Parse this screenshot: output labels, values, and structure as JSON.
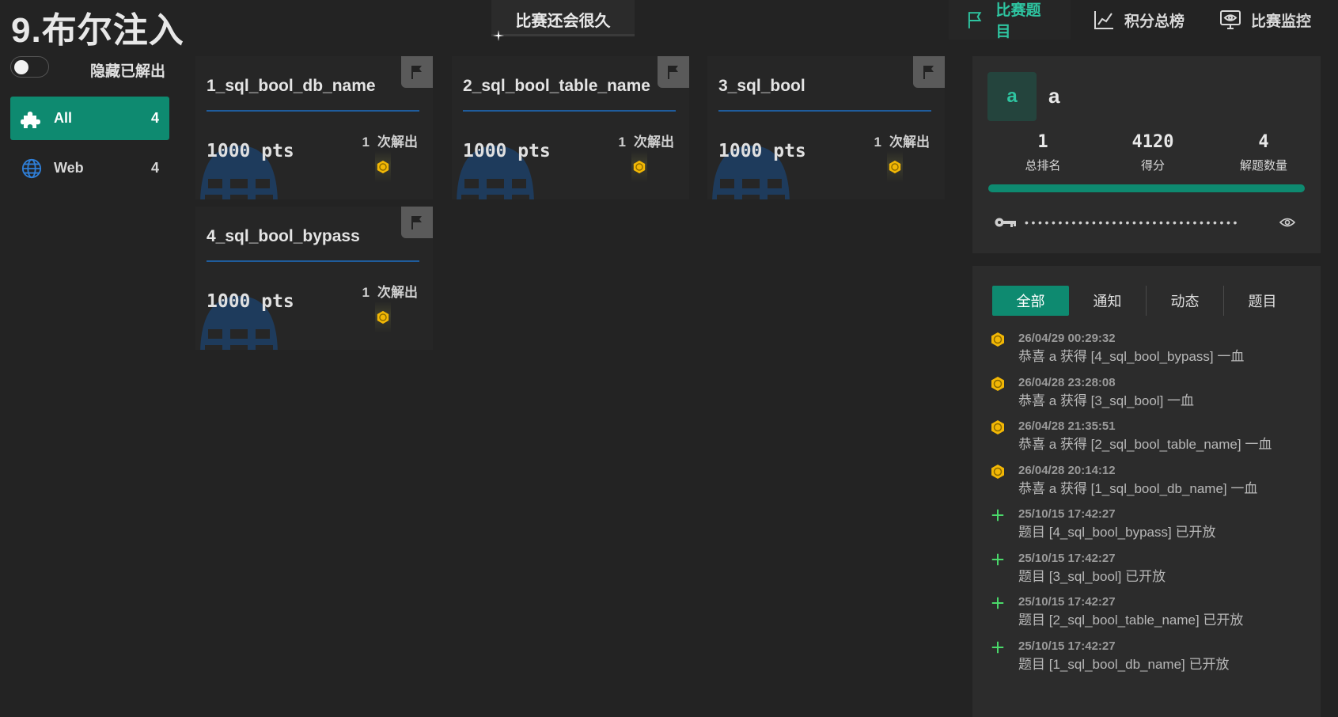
{
  "header": {
    "game_title": "9.布尔注入",
    "countdown": "比赛还会很久",
    "nav": [
      {
        "label": "比赛题目",
        "icon": "flag-icon",
        "active": true
      },
      {
        "label": "积分总榜",
        "icon": "chart-line-icon",
        "active": false
      },
      {
        "label": "比赛监控",
        "icon": "monitor-eye-icon",
        "active": false
      }
    ]
  },
  "sidebar": {
    "hide_solved_label": "隐藏已解出",
    "hide_solved_on": false,
    "categories": [
      {
        "name": "All",
        "count": "4",
        "icon": "puzzle-icon",
        "active": true
      },
      {
        "name": "Web",
        "count": "4",
        "icon": "globe-icon",
        "active": false
      }
    ]
  },
  "challenges": [
    {
      "title": "1_sql_bool_db_name",
      "points": "1000 pts",
      "solves": "1",
      "solves_label": "次解出"
    },
    {
      "title": "2_sql_bool_table_name",
      "points": "1000 pts",
      "solves": "1",
      "solves_label": "次解出"
    },
    {
      "title": "3_sql_bool",
      "points": "1000 pts",
      "solves": "1",
      "solves_label": "次解出"
    },
    {
      "title": "4_sql_bool_bypass",
      "points": "1000 pts",
      "solves": "1",
      "solves_label": "次解出"
    }
  ],
  "user": {
    "avatar_letter": "a",
    "name": "a",
    "rank": "1",
    "rank_label": "总排名",
    "score": "4120",
    "score_label": "得分",
    "solved": "4",
    "solved_label": "解题数量",
    "progress": 1.0,
    "token_masked": "••••••••••••••••••••••••••••••••"
  },
  "notices": {
    "tabs": [
      "全部",
      "通知",
      "动态",
      "题目"
    ],
    "active_tab": 0,
    "items": [
      {
        "type": "blood",
        "time": "26/04/29 00:29:32",
        "message": "恭喜 a 获得 [4_sql_bool_bypass] 一血"
      },
      {
        "type": "blood",
        "time": "26/04/28 23:28:08",
        "message": "恭喜 a 获得 [3_sql_bool] 一血"
      },
      {
        "type": "blood",
        "time": "26/04/28 21:35:51",
        "message": "恭喜 a 获得 [2_sql_bool_table_name] 一血"
      },
      {
        "type": "blood",
        "time": "26/04/28 20:14:12",
        "message": "恭喜 a 获得 [1_sql_bool_db_name] 一血"
      },
      {
        "type": "new",
        "time": "25/10/15 17:42:27",
        "message": "题目 [4_sql_bool_bypass] 已开放"
      },
      {
        "type": "new",
        "time": "25/10/15 17:42:27",
        "message": "题目 [3_sql_bool] 已开放"
      },
      {
        "type": "new",
        "time": "25/10/15 17:42:27",
        "message": "题目 [2_sql_bool_table_name] 已开放"
      },
      {
        "type": "new",
        "time": "25/10/15 17:42:27",
        "message": "题目 [1_sql_bool_db_name] 已开放"
      }
    ]
  },
  "colors": {
    "accent": "#0e8a70",
    "accent_text": "#2ec4a0",
    "medal": "#f2b705",
    "plus": "#4ad96a",
    "divider": "#1f5c9c"
  }
}
